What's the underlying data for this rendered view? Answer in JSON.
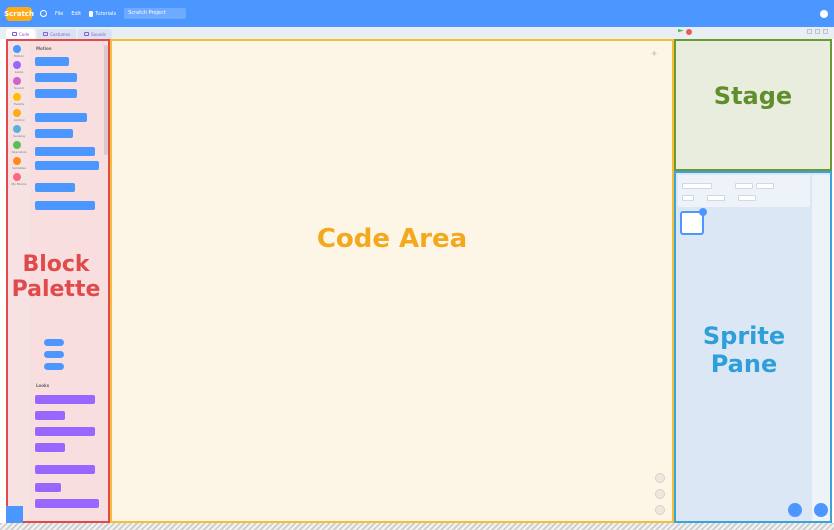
{
  "menubar": {
    "logo_text": "Scratch",
    "items": [
      "File",
      "Edit",
      "Tutorials"
    ],
    "project_title": "Scratch Project"
  },
  "tabs": [
    {
      "label": "Code"
    },
    {
      "label": "Costumes"
    },
    {
      "label": "Sounds"
    }
  ],
  "palette": {
    "categories": [
      {
        "label": "Motion",
        "color": "#4c97ff"
      },
      {
        "label": "Looks",
        "color": "#9966ff"
      },
      {
        "label": "Sound",
        "color": "#cf63cf"
      },
      {
        "label": "Events",
        "color": "#ffbf00"
      },
      {
        "label": "Control",
        "color": "#ffab19"
      },
      {
        "label": "Sensing",
        "color": "#5cb1d6"
      },
      {
        "label": "Operators",
        "color": "#59c059"
      },
      {
        "label": "Variables",
        "color": "#ff8c1a"
      },
      {
        "label": "My Blocks",
        "color": "#ff6680"
      }
    ],
    "motion_heading": "Motion",
    "looks_heading": "Looks"
  },
  "labels": {
    "block_palette": "Block Palette",
    "code_area": "Code Area",
    "stage": "Stage",
    "sprite_pane": "Sprite Pane"
  },
  "colors": {
    "palette_border": "#e04a4a",
    "code_border": "#f3bf3b",
    "stage_border": "#6b9a35",
    "sprite_border": "#3ba3d9"
  }
}
